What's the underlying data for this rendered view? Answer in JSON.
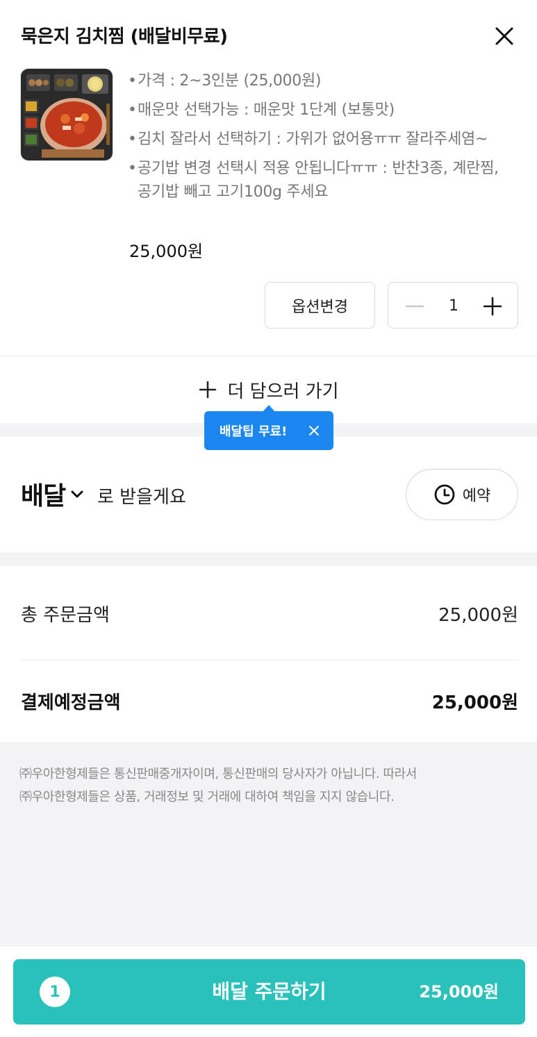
{
  "item": {
    "title": "묵은지 김치찜 (배달비무료)",
    "options": [
      "가격 : 2~3인분 (25,000원)",
      "매운맛 선택가능 : 매운맛 1단계 (보통맛)",
      "김치 잘라서 선택하기 : 가위가 없어용ㅠㅠ 잘라주세염~",
      "공기밥 변경 선택시 적용 안됩니다ㅠㅠ : 반찬3종, 계란찜, 공기밥 빼고 고기100g 주세요"
    ],
    "price": "25,000원",
    "option_change_label": "옵션변경",
    "quantity": "1"
  },
  "add_more": {
    "label": "더 담으러 가기"
  },
  "tooltip": {
    "text": "배달팁 무료!"
  },
  "delivery": {
    "mode": "배달",
    "suffix": "로 받을게요",
    "reserve_label": "예약"
  },
  "summary": {
    "total_label": "총 주문금액",
    "total_value": "25,000원",
    "pay_label": "결제예정금액",
    "pay_value": "25,000원"
  },
  "notice": {
    "line1": "㈜우아한형제들은 통신판매중개자이며, 통신판매의 당사자가 아닙니다. 따라서",
    "line2": "㈜우아한형제들은 상품, 거래정보 및 거래에 대하여 책임을 지지 않습니다."
  },
  "order": {
    "count": "1",
    "label": "배달 주문하기",
    "price": "25,000원"
  },
  "colors": {
    "accent": "#2bc1bb",
    "tooltip": "#1b86f0"
  },
  "icons": [
    "close-icon",
    "minus-icon",
    "plus-icon",
    "chevron-down-icon",
    "clock-icon"
  ]
}
